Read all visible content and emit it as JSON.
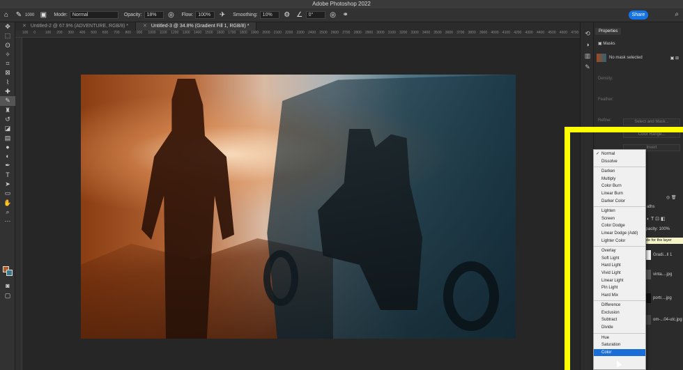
{
  "window": {
    "title": "Adobe Photoshop 2022"
  },
  "options_bar": {
    "brush_size": "1000",
    "mode_label": "Mode:",
    "mode_value": "Normal",
    "opacity_label": "Opacity:",
    "opacity_value": "18%",
    "flow_label": "Flow:",
    "flow_value": "100%",
    "smoothing_label": "Smoothing:",
    "smoothing_value": "10%",
    "angle_value": "0°",
    "share_label": "Share"
  },
  "tabs": [
    {
      "label": "Untitled-2 @ 67.9% (ADVENTURE, RGB/8) *",
      "active": false
    },
    {
      "label": "Untitled-3 @ 34.8% (Gradient Fill 1, RGB/8) *",
      "active": true
    }
  ],
  "ruler_ticks": [
    "100",
    "0",
    "100",
    "200",
    "300",
    "400",
    "500",
    "600",
    "700",
    "800",
    "900",
    "1000",
    "1100",
    "1200",
    "1300",
    "1400",
    "1500",
    "1600",
    "1700",
    "1800",
    "1900",
    "2000",
    "2100",
    "2200",
    "2300",
    "2400",
    "2500",
    "2600",
    "2700",
    "2800",
    "2900",
    "3000",
    "3100",
    "3200",
    "3300",
    "3400",
    "3500",
    "3600",
    "3700",
    "3800",
    "3900",
    "4000",
    "4100",
    "4200",
    "4300",
    "4400",
    "4500",
    "4600",
    "4700",
    "4800"
  ],
  "properties": {
    "tab_label": "Properties",
    "masks_label": "Masks",
    "no_mask": "No mask selected",
    "density_label": "Density:",
    "feather_label": "Feather:",
    "refine_label": "Refine:",
    "select_mask_button": "Select and Mask...",
    "color_range_button": "Color Range...",
    "invert_button": "Invert",
    "paths_label": "aths",
    "opacity_text": "Opacity: 100%",
    "tooltip": "ode for the layer",
    "layers": [
      {
        "name": "Gradi...ll 1"
      },
      {
        "name": "vinta....jpg"
      },
      {
        "name": "portr....jpg"
      },
      {
        "name": "om-...04-utc.jpg"
      }
    ]
  },
  "blend_menu": {
    "groups": [
      [
        "Normal",
        "Dissolve"
      ],
      [
        "Darken",
        "Multiply",
        "Color Burn",
        "Linear Burn",
        "Darker Color"
      ],
      [
        "Lighten",
        "Screen",
        "Color Dodge",
        "Linear Dodge (Add)",
        "Lighter Color"
      ],
      [
        "Overlay",
        "Soft Light",
        "Hard Light",
        "Vivid Light",
        "Linear Light",
        "Pin Light",
        "Hard Mix"
      ],
      [
        "Difference",
        "Exclusion",
        "Subtract",
        "Divide"
      ],
      [
        "Hue",
        "Saturation",
        "Color"
      ]
    ],
    "checked": "Normal",
    "selected": "Color"
  },
  "colors": {
    "foreground": "#b05a25",
    "background": "#3a7a88",
    "highlight": "#ffff00",
    "accent": "#1a6ed8"
  }
}
